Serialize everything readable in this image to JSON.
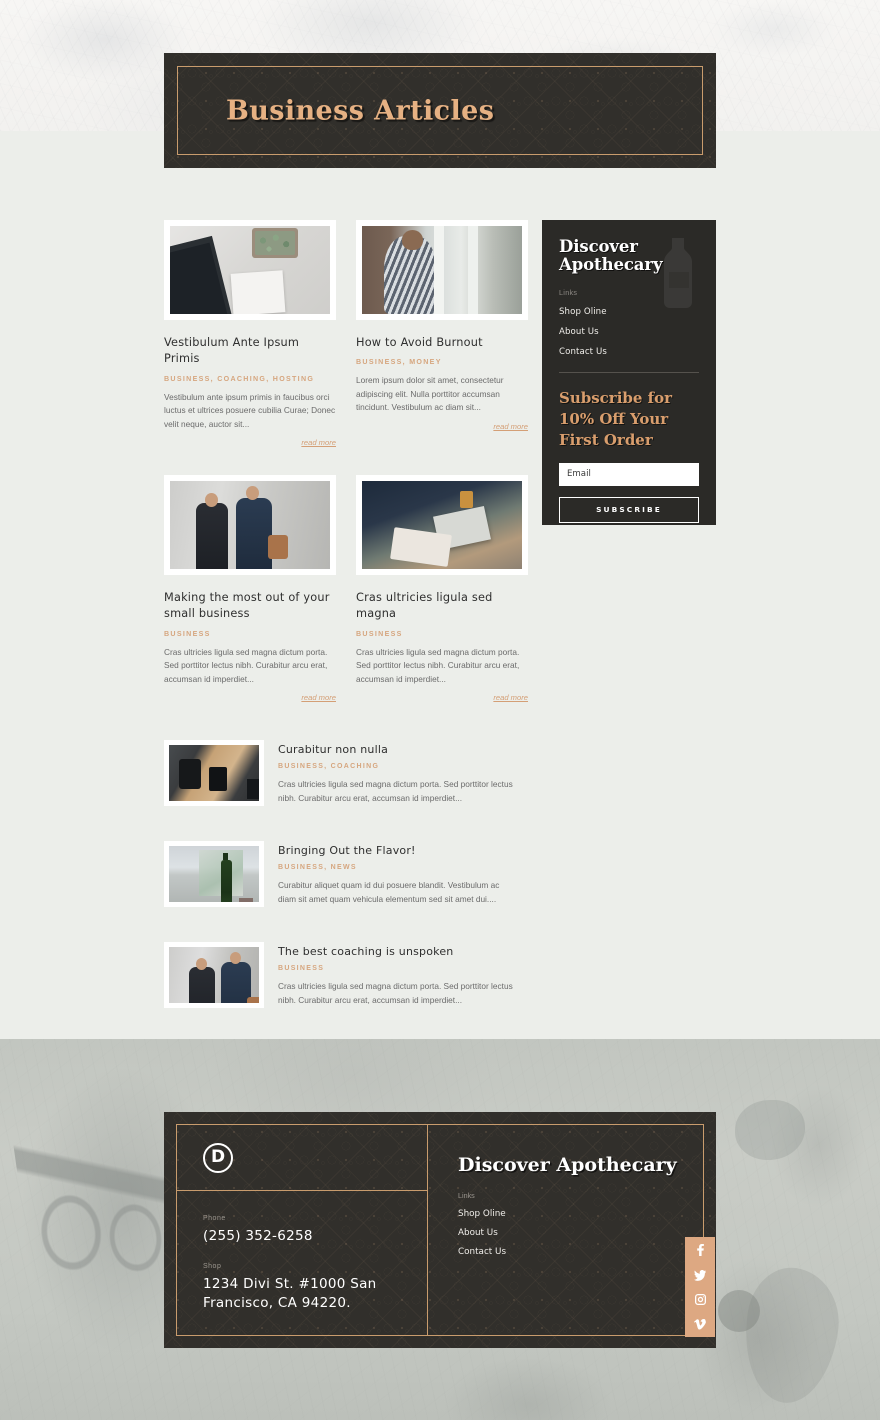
{
  "theme": {
    "page_bg": "#eceeea",
    "dark_panel": "#2b2a27",
    "gold_border": "#c99c6d",
    "accent_tan": "#d6a67f",
    "promo_tan": "#d99e6d",
    "social_bar_bg": "#dda882"
  },
  "hero": {
    "title": "Business Articles"
  },
  "articles": [
    {
      "title": "Vestibulum Ante Ipsum Primis",
      "categories": "BUSINESS, COACHING, HOSTING",
      "excerpt": "Vestibulum ante ipsum primis in faucibus orci luctus et ultrices posuere cubilia Curae; Donec velit neque, auctor sit...",
      "read_more": "read more",
      "image_name": "desk-laptop-succulent-photo"
    },
    {
      "title": "How to Avoid Burnout",
      "categories": "BUSINESS, MONEY",
      "excerpt": "Lorem ipsum dolor sit amet, consectetur adipiscing elit. Nulla porttitor accumsan tincidunt. Vestibulum ac diam sit...",
      "read_more": "read more",
      "image_name": "woman-by-window-photo"
    },
    {
      "title": "Making the most out of your small business",
      "categories": "BUSINESS",
      "excerpt": "Cras ultricies ligula sed magna dictum porta. Sed porttitor lectus nibh. Curabitur arcu erat, accumsan id imperdiet...",
      "read_more": "read more",
      "image_name": "two-men-in-suits-photo"
    },
    {
      "title": "Cras ultricies ligula sed magna",
      "categories": "BUSINESS",
      "excerpt": "Cras ultricies ligula sed magna dictum porta. Sed porttitor lectus nibh. Curabitur arcu erat, accumsan id imperdiet...",
      "read_more": "read more",
      "image_name": "hands-tablet-laptop-photo"
    }
  ],
  "list_articles": [
    {
      "title": "Curabitur non nulla",
      "categories": "BUSINESS, COACHING",
      "excerpt": "Cras ultricies ligula sed magna dictum porta. Sed porttitor lectus nibh. Curabitur arcu erat, accumsan id imperdiet...",
      "image_name": "overhead-dark-desk-photo"
    },
    {
      "title": "Bringing Out the Flavor!",
      "categories": "BUSINESS, NEWS",
      "excerpt": "Curabitur aliquet quam id dui posuere blandit. Vestibulum ac diam sit amet quam vehicula elementum sed sit amet dui....",
      "image_name": "wine-bottle-table-photo"
    },
    {
      "title": "The best coaching is unspoken",
      "categories": "BUSINESS",
      "excerpt": "Cras ultricies ligula sed magna dictum porta. Sed porttitor lectus nibh. Curabitur arcu erat, accumsan id imperdiet...",
      "image_name": "two-men-in-suits-photo"
    }
  ],
  "sidebar": {
    "heading": "Discover Apothecary",
    "links_label": "Links",
    "links": [
      "Shop Oline",
      "About Us",
      "Contact Us"
    ],
    "promo_heading": "Subscribe for 10% Off Your First Order",
    "email_placeholder": "Email",
    "email_value": "",
    "subscribe_label": "SUBSCRIBE"
  },
  "footer": {
    "logo_letter": "D",
    "phone_label": "Phone",
    "phone_value": "(255) 352-6258",
    "shop_label": "Shop",
    "shop_value": "1234 Divi St. #1000 San Francisco, CA 94220.",
    "heading": "Discover Apothecary",
    "links_label": "Links",
    "links": [
      "Shop Oline",
      "About Us",
      "Contact Us"
    ],
    "social": [
      "facebook-icon",
      "twitter-icon",
      "instagram-icon",
      "vimeo-icon"
    ]
  }
}
